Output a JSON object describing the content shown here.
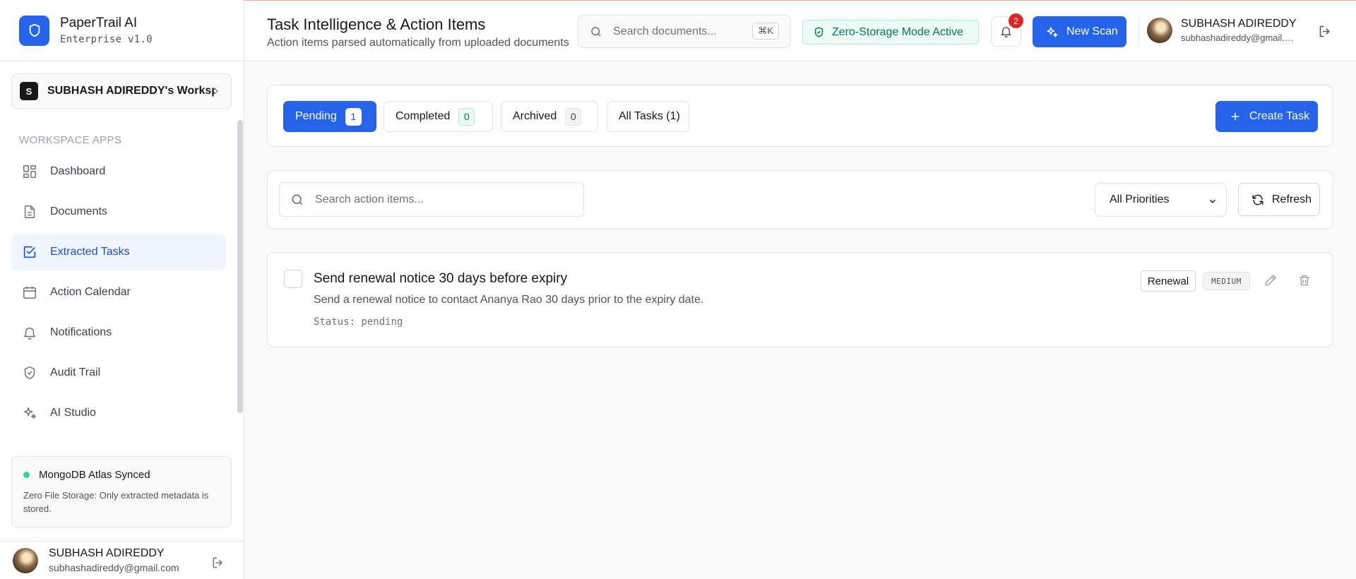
{
  "brand": {
    "name": "PaperTrail AI",
    "subtitle": "Enterprise v1.0"
  },
  "workspace": {
    "initial": "S",
    "name": "SUBHASH ADIREDDY's Workspace"
  },
  "sidebar": {
    "section_label": "WORKSPACE APPS",
    "items": [
      {
        "label": "Dashboard",
        "icon": "dashboard-icon",
        "active": false
      },
      {
        "label": "Documents",
        "icon": "document-icon",
        "active": false
      },
      {
        "label": "Extracted Tasks",
        "icon": "checkbox-icon",
        "active": true
      },
      {
        "label": "Action Calendar",
        "icon": "calendar-icon",
        "active": false
      },
      {
        "label": "Notifications",
        "icon": "bell-icon",
        "active": false
      },
      {
        "label": "Audit Trail",
        "icon": "shield-check-icon",
        "active": false
      },
      {
        "label": "AI Studio",
        "icon": "sparkles-icon",
        "active": false
      }
    ],
    "db_card": {
      "title": "MongoDB Atlas Synced",
      "description": "Zero File Storage: Only extracted metadata is stored."
    }
  },
  "user": {
    "name": "SUBHASH ADIREDDY",
    "email": "subhashadireddy@gmail.com"
  },
  "header": {
    "title": "Task Intelligence & Action Items",
    "subtitle": "Action items parsed automatically from uploaded documents",
    "search_placeholder": "Search documents...",
    "shortcut": "⌘K",
    "zero_storage": "Zero-Storage Mode Active",
    "notification_count": "2",
    "new_scan": "New Scan"
  },
  "tabs": [
    {
      "label": "Pending",
      "count": "1",
      "active": true
    },
    {
      "label": "Completed",
      "count": "0",
      "active": false
    },
    {
      "label": "Archived",
      "count": "0",
      "active": false
    },
    {
      "label": "All Tasks (1)",
      "count": null,
      "active": false
    }
  ],
  "create_task": "Create Task",
  "filters": {
    "search_placeholder": "Search action items...",
    "priority_selected": "All Priorities",
    "refresh": "Refresh"
  },
  "tasks": [
    {
      "title": "Send renewal notice 30 days before expiry",
      "description": "Send a renewal notice to contact Ananya Rao 30 days prior to the expiry date.",
      "status": "Status: pending",
      "tag": "Renewal",
      "priority": "MEDIUM"
    }
  ],
  "colors": {
    "accent": "#2563eb",
    "success": "#047857",
    "danger": "#dc2626"
  }
}
